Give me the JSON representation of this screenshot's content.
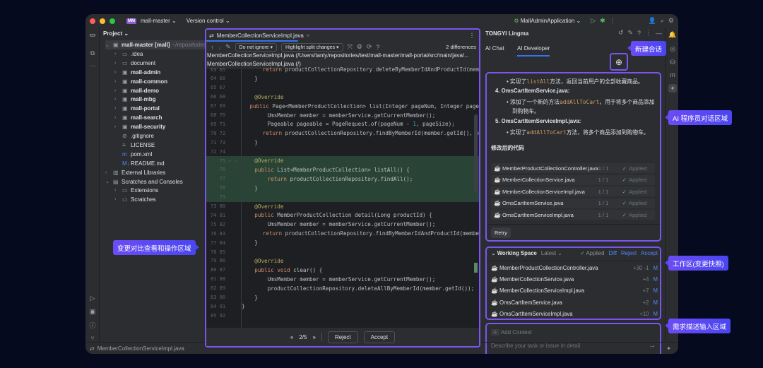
{
  "titlebar": {
    "project": "mall-master",
    "project_badge": "MM",
    "vcs": "Version control",
    "run_config": "MallAdminApplication"
  },
  "project_panel": {
    "title": "Project",
    "tree": [
      {
        "label": "mall-master [mall]",
        "suffix": "~/repositories",
        "depth": 0,
        "expanded": true,
        "bold": true,
        "icon": "module-folder-icon"
      },
      {
        "label": ".idea",
        "depth": 1,
        "icon": "folder-icon"
      },
      {
        "label": "document",
        "depth": 1,
        "icon": "folder-icon"
      },
      {
        "label": "mall-admin",
        "depth": 1,
        "bold": true,
        "icon": "module-folder-icon"
      },
      {
        "label": "mall-common",
        "depth": 1,
        "bold": true,
        "icon": "module-folder-icon"
      },
      {
        "label": "mall-demo",
        "depth": 1,
        "bold": true,
        "icon": "module-folder-icon"
      },
      {
        "label": "mall-mbg",
        "depth": 1,
        "bold": true,
        "icon": "module-folder-icon"
      },
      {
        "label": "mall-portal",
        "depth": 1,
        "bold": true,
        "icon": "module-folder-icon"
      },
      {
        "label": "mall-search",
        "depth": 1,
        "bold": true,
        "icon": "module-folder-icon"
      },
      {
        "label": "mall-security",
        "depth": 1,
        "bold": true,
        "icon": "module-folder-icon"
      },
      {
        "label": ".gitignore",
        "depth": 1,
        "leaf": true,
        "icon": "ignore-file-icon"
      },
      {
        "label": "LICENSE",
        "depth": 1,
        "leaf": true,
        "icon": "text-file-icon"
      },
      {
        "label": "pom.xml",
        "depth": 1,
        "leaf": true,
        "icon": "maven-icon"
      },
      {
        "label": "README.md",
        "depth": 1,
        "leaf": true,
        "icon": "markdown-icon"
      },
      {
        "label": "External Libraries",
        "depth": 0,
        "icon": "library-icon"
      },
      {
        "label": "Scratches and Consoles",
        "depth": 0,
        "expanded": true,
        "icon": "scratches-icon"
      },
      {
        "label": "Extensions",
        "depth": 1,
        "icon": "folder-icon"
      },
      {
        "label": "Scratches",
        "depth": 1,
        "icon": "folder-icon"
      }
    ]
  },
  "editor": {
    "tab": "MemberCollectionServiceImpl.java",
    "ignore_option": "Do not ignore",
    "highlight_option": "Highlight split changes",
    "differences": "2 differences",
    "left_path": "MemberCollectionServiceImpl.java (/Users/tanly/repositories/test/mall-master/mall-portal/src/main/java/...",
    "right_path": "MemberCollectionServiceImpl.java (/)",
    "lines": [
      {
        "l": "63",
        "r": "65",
        "code": "        return productCollectionRepository.deleteByMemberIdAndProductId(mem"
      },
      {
        "l": "64",
        "r": "66",
        "code": "    }"
      },
      {
        "l": "65",
        "r": "67",
        "code": ""
      },
      {
        "l": "66",
        "r": "68",
        "code": "    @Override"
      },
      {
        "l": "67",
        "r": "69",
        "code": "    public Page<MemberProductCollection> list(Integer pageNum, Integer page"
      },
      {
        "l": "68",
        "r": "70",
        "code": "        UmsMember member = memberService.getCurrentMember();"
      },
      {
        "l": "69",
        "r": "71",
        "code": "        Pageable pageable = PageRequest.of(pageNum - 1, pageSize);"
      },
      {
        "l": "70",
        "r": "72",
        "code": "        return productCollectionRepository.findByMemberId(member.getId(), p"
      },
      {
        "l": "71",
        "r": "73",
        "code": "    }"
      },
      {
        "l": "72",
        "r": "74",
        "code": ""
      },
      {
        "l": "",
        "r": "75",
        "code": "    @Override",
        "added": true
      },
      {
        "l": "",
        "r": "76",
        "code": "    public List<MemberProductCollection> listAll() {",
        "added": true
      },
      {
        "l": "",
        "r": "77",
        "code": "        return productCollectionRepository.findAll();",
        "added": true
      },
      {
        "l": "",
        "r": "78",
        "code": "    }",
        "added": true
      },
      {
        "l": "",
        "r": "79",
        "code": "",
        "added": true
      },
      {
        "l": "73",
        "r": "80",
        "code": "    @Override"
      },
      {
        "l": "74",
        "r": "81",
        "code": "    public MemberProductCollection detail(Long productId) {"
      },
      {
        "l": "75",
        "r": "82",
        "code": "        UmsMember member = memberService.getCurrentMember();"
      },
      {
        "l": "76",
        "r": "83",
        "code": "        return productCollectionRepository.findByMemberIdAndProductId(membe"
      },
      {
        "l": "77",
        "r": "84",
        "code": "    }"
      },
      {
        "l": "78",
        "r": "85",
        "code": ""
      },
      {
        "l": "79",
        "r": "86",
        "code": "    @Override"
      },
      {
        "l": "80",
        "r": "87",
        "code": "    public void clear() {"
      },
      {
        "l": "81",
        "r": "88",
        "code": "        UmsMember member = memberService.getCurrentMember();"
      },
      {
        "l": "82",
        "r": "89",
        "code": "        productCollectionRepository.deleteAllByMemberId(member.getId());"
      },
      {
        "l": "83",
        "r": "90",
        "code": "    }"
      },
      {
        "l": "84",
        "r": "91",
        "code": "}"
      },
      {
        "l": "85",
        "r": "92",
        "code": ""
      }
    ],
    "pager": "2/5",
    "reject": "Reject",
    "accept": "Accept"
  },
  "ai_panel": {
    "title": "TONGYI Lingma",
    "tabs": [
      {
        "label": "AI Chat",
        "active": false
      },
      {
        "label": "AI Developer",
        "active": true
      }
    ],
    "chat": {
      "b1_pre": "实现了",
      "b1_code": "listAll",
      "b1_post": "方法，返回当前用户的全部收藏商品。",
      "item4": "4.  OmsCartItemService.java:",
      "b2_pre": "添加了一个新的方法",
      "b2_code": "addAllToCart",
      "b2_post": "，用于将多个商品添加",
      "b2_cont": "到购物车。",
      "item5": "5.  OmsCartItemServiceImpl.java:",
      "b3_pre": "实现了",
      "b3_code": "addAllToCart",
      "b3_post": "方法，将多个商品添加到购物车。",
      "heading": "修改后的代码",
      "files": [
        {
          "name": "MemberProductCollectionController.java",
          "count": "1 / 1",
          "status": "Applied"
        },
        {
          "name": "MemberCollectionService.java",
          "count": "1 / 1",
          "status": "Applied"
        },
        {
          "name": "MemberCollectionServiceImpl.java",
          "count": "1 / 1",
          "status": "Applied"
        },
        {
          "name": "OmsCartItemService.java",
          "count": "1 / 1",
          "status": "Applied"
        },
        {
          "name": "OmsCartItemServiceImpl.java",
          "count": "1 / 1",
          "status": "Applied"
        }
      ],
      "retry": "Retry"
    },
    "workspace": {
      "title": "Working Space",
      "version": "Latest",
      "status": "Applied",
      "diff": "Diff",
      "reject": "Reject",
      "accept": "Accept",
      "files": [
        {
          "name": "MemberProductCollectionController.java",
          "changes": "+30 -1",
          "flag": "M"
        },
        {
          "name": "MemberCollectionService.java",
          "changes": "+4",
          "flag": "M"
        },
        {
          "name": "MemberCollectionServiceImpl.java",
          "changes": "+7",
          "flag": "M"
        },
        {
          "name": "OmsCartItemService.java",
          "changes": "+2",
          "flag": "M"
        },
        {
          "name": "OmsCartItemServiceImpl.java",
          "changes": "+10",
          "flag": "M"
        }
      ]
    },
    "input": {
      "add_context": "Add Context",
      "placeholder": "Describe your task or issue in detail"
    }
  },
  "callouts": {
    "new_chat": "新建会话",
    "ai_area": "AI 程序员对话区域",
    "workspace": "工作区(变更快照)",
    "input": "需求描述输入区域",
    "diff_area": "变更对比查看和操作区域"
  },
  "status_bar": {
    "file": "MemberCollectionServiceImpl.java"
  },
  "colors": {
    "accent": "#7b55f0",
    "added_bg": "#294436",
    "applied": "#5fb865",
    "link": "#548af7"
  }
}
